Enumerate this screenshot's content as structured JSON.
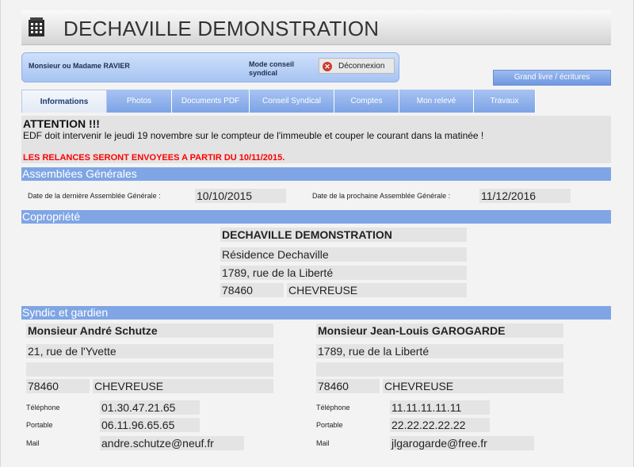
{
  "app": {
    "title": "DECHAVILLE DEMONSTRATION"
  },
  "user": {
    "name": "Monsieur ou Madame RAVIER",
    "mode_label": "Mode conseil syndical",
    "logout_label": "Déconnexion",
    "ledger_label": "Grand livre / écritures"
  },
  "tabs": [
    {
      "label": "Informations",
      "active": true
    },
    {
      "label": "Photos"
    },
    {
      "label": "Documents PDF"
    },
    {
      "label": "Conseil Syndical"
    },
    {
      "label": "Comptes"
    },
    {
      "label": "Mon relevé"
    },
    {
      "label": "Travaux"
    }
  ],
  "notice": {
    "title": "ATTENTION !!!",
    "body": "EDF doit intervenir le jeudi 19 novembre sur le compteur de l'immeuble et couper le courant dans la matinée !",
    "alert": "LES RELANCES SERONT ENVOYEES A PARTIR DU 10/11/2015."
  },
  "assemblies": {
    "heading": "Assemblées Générales",
    "last_label": "Date de la dernière Assemblée Générale :",
    "last_value": "10/10/2015",
    "next_label": "Date de la prochaine Assemblée Générale :",
    "next_value": "11/12/2016"
  },
  "coproperty": {
    "heading": "Copropriété",
    "name": "DECHAVILLE DEMONSTRATION",
    "residence": "Résidence Dechaville",
    "street": "1789, rue de la Liberté",
    "postcode": "78460",
    "city": "CHEVREUSE"
  },
  "syndic": {
    "heading": "Syndic et gardien",
    "phone_label": "Téléphone",
    "mobile_label": "Portable",
    "mail_label": "Mail",
    "left": {
      "name": "Monsieur André Schutze",
      "street": "21, rue de l'Yvette",
      "line2": "",
      "postcode": "78460",
      "city": "CHEVREUSE",
      "phone": "01.30.47.21.65",
      "mobile": "06.11.96.65.65",
      "mail": "andre.schutze@neuf.fr"
    },
    "right": {
      "name": "Monsieur Jean-Louis GAROGARDE",
      "street": "1789, rue de la Liberté",
      "line2": "",
      "postcode": "78460",
      "city": "CHEVREUSE",
      "phone": "11.11.11.11.11",
      "mobile": "22.22.22.22.22",
      "mail": "jlgarogarde@free.fr"
    }
  },
  "colors": {
    "accent": "#7fa5e4",
    "alert": "#ff0000"
  }
}
